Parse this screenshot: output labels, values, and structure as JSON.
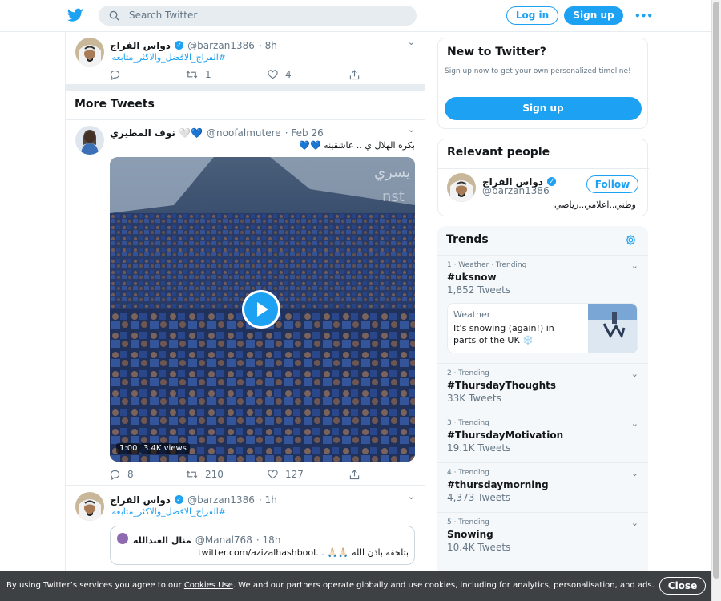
{
  "header": {
    "search_placeholder": "Search Twitter",
    "login_label": "Log in",
    "signup_label": "Sign up",
    "more_label": "•••"
  },
  "tweet_top": {
    "name": "دواس الفراج",
    "handle": "@barzan1386",
    "time": "· 8h",
    "hashtag": "#الفراج_الافضل_والاكثر_متابعه",
    "retweets": "1",
    "likes": "4"
  },
  "more_tweets_title": "More Tweets",
  "tweet_video": {
    "name": "نوف المطيري 🤍💙",
    "handle": "@noofalmutere",
    "time": "· Feb 26",
    "text": "بكره الهلال ي .. عاشقينه 💙💙",
    "video_duration": "1:00",
    "video_views": "3.4K views",
    "replies": "8",
    "retweets": "210",
    "likes": "127"
  },
  "tweet_bottom": {
    "name": "دواس الفراج",
    "handle": "@barzan1386",
    "time": "· 1h",
    "hashtag": "#الفراج_الافضل_والاكثر_متابعه",
    "quote": {
      "name": "منال العبدالله",
      "handle": "@Manal768",
      "time": "· 18h",
      "text": "بتلحقه باذن الله 🙏🏻🙏🏻 ...twitter.com/azizalhashbool"
    }
  },
  "new_to_twitter": {
    "title": "New to Twitter?",
    "description": "Sign up now to get your own personalized timeline!",
    "button": "Sign up"
  },
  "relevant_people": {
    "title": "Relevant people",
    "name": "دواس الفراج",
    "handle": "@barzan1386",
    "bio": "وطني..اعلامي..رياضي",
    "follow": "Follow"
  },
  "trends": {
    "title": "Trends",
    "items": [
      {
        "meta": "1 · Weather · Trending",
        "name": "#uksnow",
        "count": "1,852 Tweets"
      },
      {
        "meta": "2 · Trending",
        "name": "#ThursdayThoughts",
        "count": "33K Tweets"
      },
      {
        "meta": "3 · Trending",
        "name": "#ThursdayMotivation",
        "count": "19.1K Tweets"
      },
      {
        "meta": "4 · Trending",
        "name": "#thursdaymorning",
        "count": "4,373 Tweets"
      },
      {
        "meta": "5 · Trending",
        "name": "Snowing",
        "count": "10.4K Tweets"
      }
    ],
    "news": {
      "category": "Weather",
      "headline": "It's snowing (again!) in parts of the UK ❄️"
    }
  },
  "cookie": {
    "text_before": "By using Twitter’s services you agree to our ",
    "link": "Cookies Use",
    "text_after": ". We and our partners operate globally and use cookies, including for analytics, personalisation, and ads.",
    "close": "Close"
  },
  "colors": {
    "accent": "#1da1f2",
    "border": "#e6ecf0",
    "muted": "#657786"
  }
}
